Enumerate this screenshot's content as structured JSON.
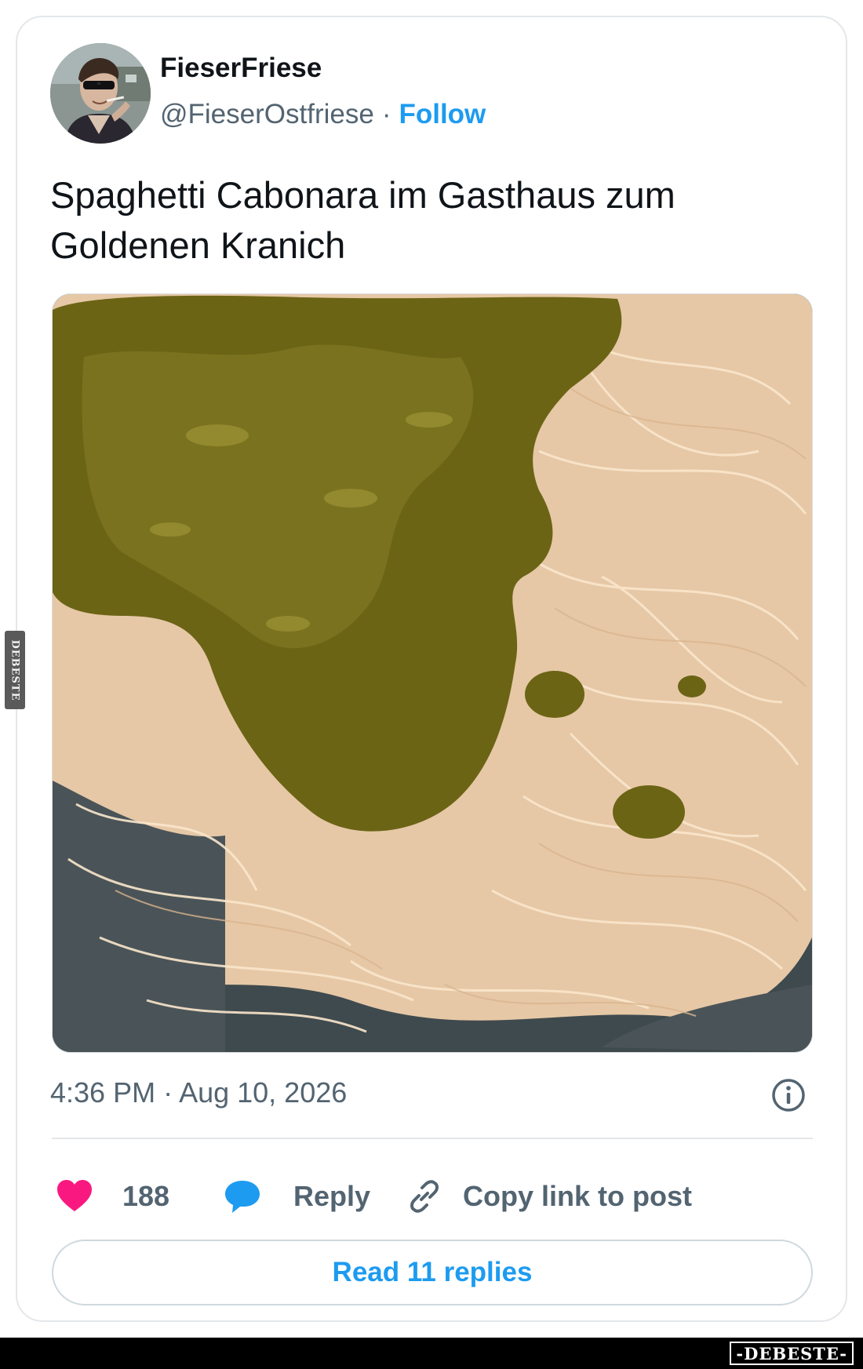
{
  "post": {
    "author": {
      "display_name": "FieserFriese",
      "handle": "@FieserOstfriese",
      "separator": "·",
      "follow_label": "Follow",
      "avatar_icon": "user-avatar-photo"
    },
    "text": "Spaghetti Cabonara im Gasthaus zum Goldenen Kranich",
    "media": {
      "kind": "photo",
      "subject": "spaghetti-with-green-sauce"
    },
    "timestamp": "4:36 PM · Aug 10, 2026",
    "info_icon": "info-icon"
  },
  "actions": {
    "like": {
      "icon": "heart-icon",
      "count": "188",
      "color": "#f91880"
    },
    "reply": {
      "icon": "speech-bubble-icon",
      "label": "Reply",
      "color": "#1d9bf0"
    },
    "copy_link": {
      "icon": "link-icon",
      "label": "Copy link to post"
    }
  },
  "read_replies_label": "Read 11 replies",
  "watermark": {
    "side_text": "DEBESTE",
    "bottom_text": "-DEBESTE-"
  },
  "colors": {
    "accent": "#1d9bf0",
    "like": "#f91880",
    "text_primary": "#0f1419",
    "text_secondary": "#536471",
    "border": "#e4e7ea"
  }
}
